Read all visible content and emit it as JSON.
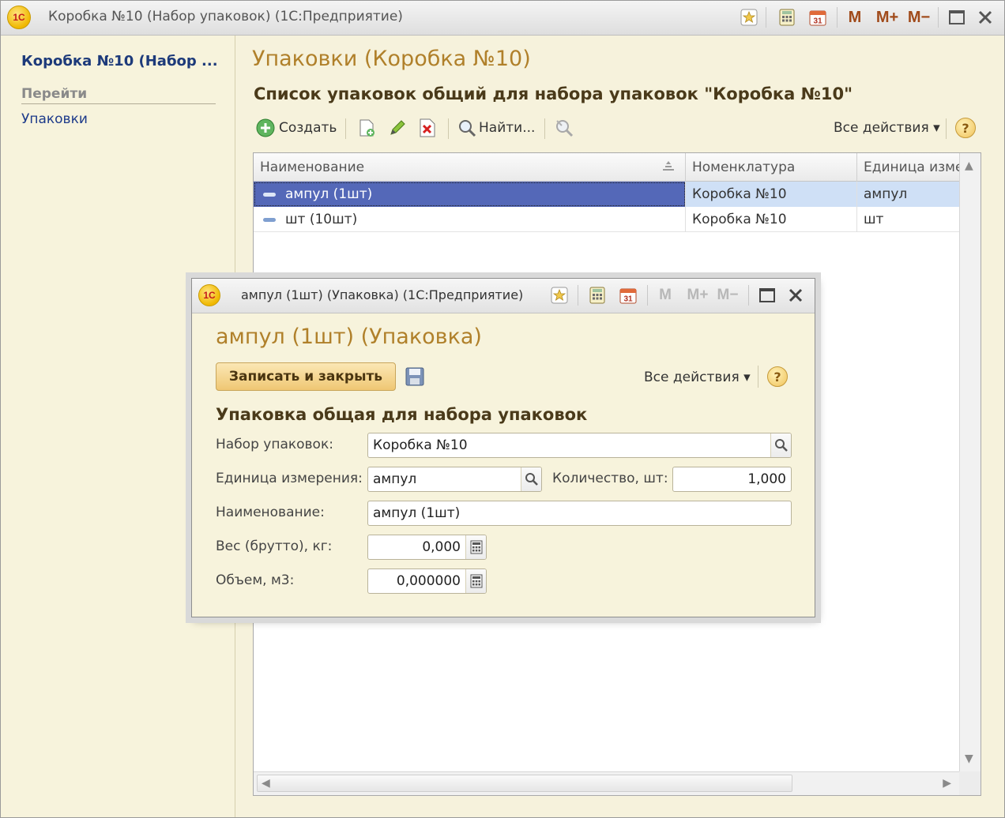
{
  "window": {
    "logo": "1С",
    "title": "Коробка №10 (Набор упаковок)  (1С:Предприятие)",
    "controls": {
      "m": "M",
      "m_plus": "M+",
      "m_minus": "M−"
    }
  },
  "sidebar": {
    "title": "Коробка №10 (Набор ...",
    "section": "Перейти",
    "links": [
      {
        "label": "Упаковки"
      }
    ]
  },
  "content": {
    "title": "Упаковки (Коробка №10)",
    "heading": "Список упаковок общий для набора упаковок \"Коробка №10\"",
    "toolbar": {
      "create": "Создать",
      "find": "Найти...",
      "all_actions": "Все действия ▾",
      "help": "?"
    },
    "table": {
      "columns": [
        "Наименование",
        "Номенклатура",
        "Единица изме"
      ],
      "rows": [
        {
          "name": "ампул (1шт)",
          "nomenclature": "Коробка №10",
          "unit": "ампул",
          "selected": true
        },
        {
          "name": "шт (10шт)",
          "nomenclature": "Коробка №10",
          "unit": "шт",
          "selected": false
        }
      ]
    }
  },
  "modal": {
    "logo": "1С",
    "title": "ампул (1шт) (Упаковка)  (1С:Предприятие)",
    "controls": {
      "m": "M",
      "m_plus": "M+",
      "m_minus": "M−"
    },
    "heading": "ампул (1шт) (Упаковка)",
    "save_close": "Записать и закрыть",
    "all_actions": "Все действия ▾",
    "help": "?",
    "section": "Упаковка общая для набора упаковок",
    "fields": {
      "set_label": "Набор упаковок:",
      "set_value": "Коробка №10",
      "unit_label": "Единица измерения:",
      "unit_value": "ампул",
      "qty_label": "Количество, шт:",
      "qty_value": "1,000",
      "name_label": "Наименование:",
      "name_value": "ампул (1шт)",
      "weight_label": "Вес (брутто), кг:",
      "weight_value": "0,000",
      "volume_label": "Объем, м3:",
      "volume_value": "0,000000"
    }
  },
  "icons": [
    "favorite-star-icon",
    "calculator-icon",
    "calendar-icon",
    "maximize-icon",
    "close-icon",
    "add-icon",
    "copy-icon",
    "edit-icon",
    "delete-icon",
    "search-icon",
    "search-cancel-icon",
    "help-icon",
    "sort-icon",
    "save-icon"
  ]
}
